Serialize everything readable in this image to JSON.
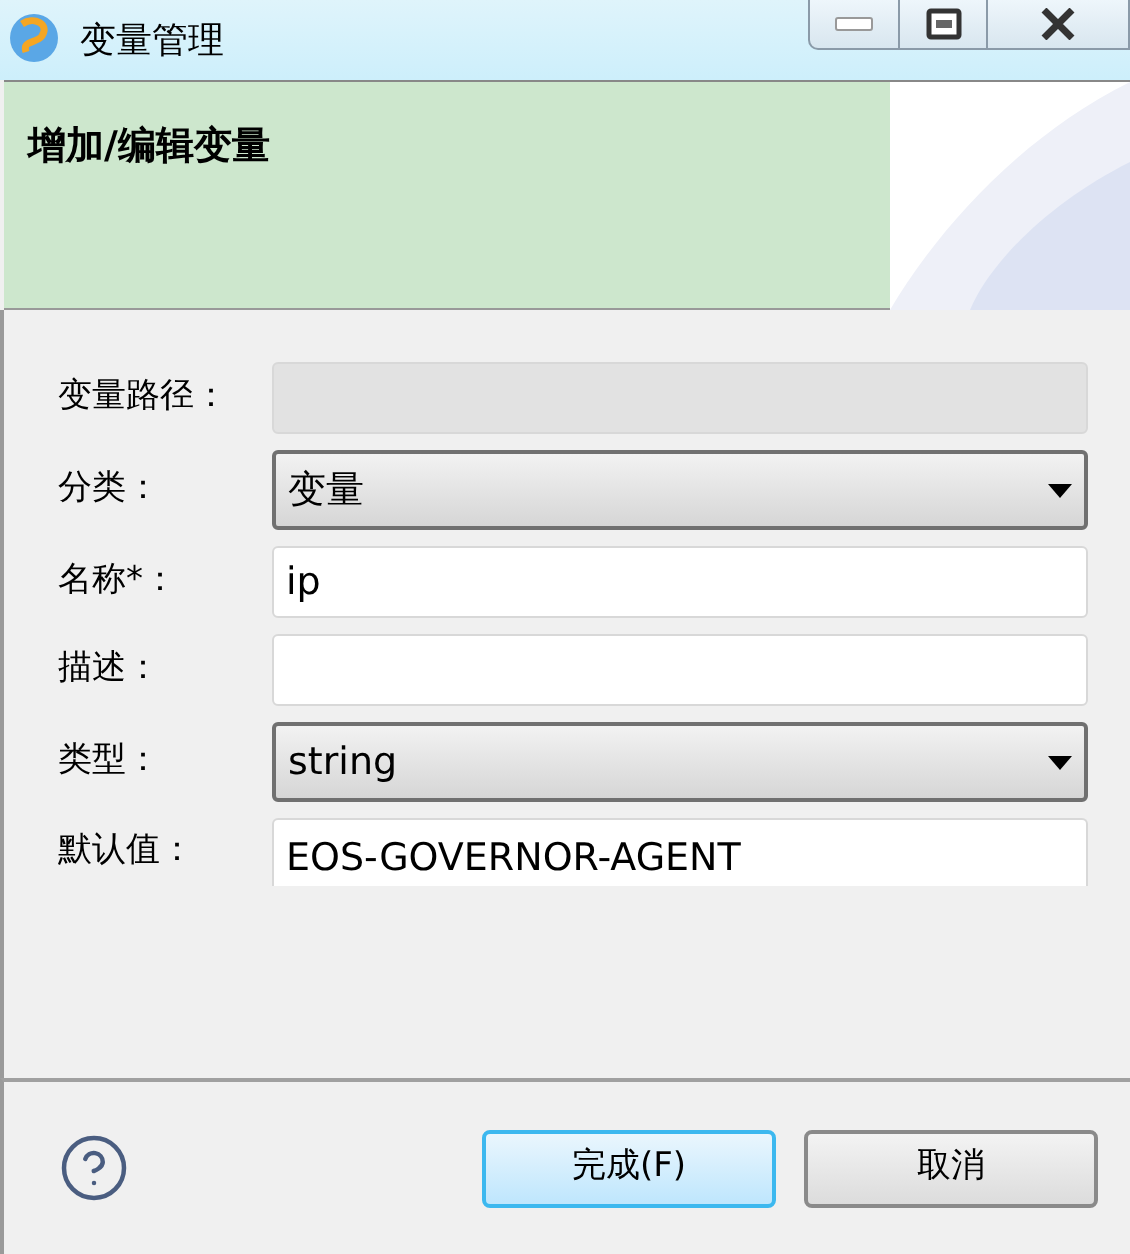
{
  "window": {
    "title": "变量管理"
  },
  "header": {
    "title": "增加/编辑变量"
  },
  "fields": [
    {
      "label": "变量路径：",
      "kind": "text",
      "disabled": true
    },
    {
      "label": "分类：",
      "kind": "select",
      "value": "变量",
      "disabled": false
    },
    {
      "label": "名称*：",
      "kind": "text",
      "value": "ip",
      "disabled": false
    },
    {
      "label": "描述：",
      "kind": "text",
      "disabled": false
    },
    {
      "label": "类型：",
      "kind": "select",
      "value": "string",
      "disabled": false
    },
    {
      "label": "默认值：",
      "kind": "text",
      "value": "EOS-GOVERNOR-AGENT",
      "disabled": false
    }
  ],
  "buttons": [
    {
      "label": "完成(F)",
      "selected": true
    },
    {
      "label": "取消",
      "selected": false
    }
  ]
}
